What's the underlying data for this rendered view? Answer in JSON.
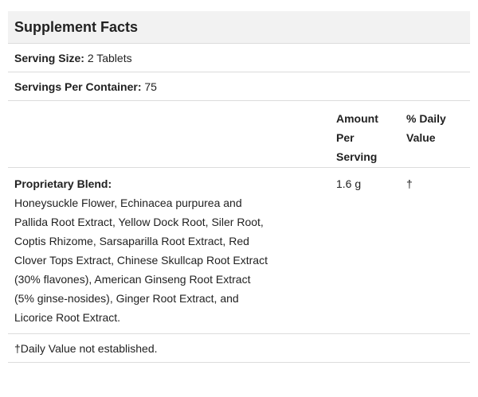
{
  "title": "Supplement Facts",
  "serving_size": {
    "label": "Serving Size:",
    "value": "2 Tablets"
  },
  "servings_per_container": {
    "label": "Servings Per Container:",
    "value": "75"
  },
  "columns": {
    "amount": "Amount Per Serving",
    "daily_value": "% Daily Value"
  },
  "blend": {
    "title": "Proprietary Blend:",
    "ingredients": "Honeysuckle Flower, Echinacea purpurea and Pallida Root Extract, Yellow Dock Root, Siler Root, Coptis Rhizome, Sarsaparilla Root Extract, Red Clover Tops Extract, Chinese Skullcap Root Extract (30% flavones), American Ginseng Root Extract (5% ginse-nosides), Ginger Root Extract, and Licorice Root Extract.",
    "amount": "1.6 g",
    "daily_value": "†"
  },
  "footnote": "†Daily Value not established."
}
